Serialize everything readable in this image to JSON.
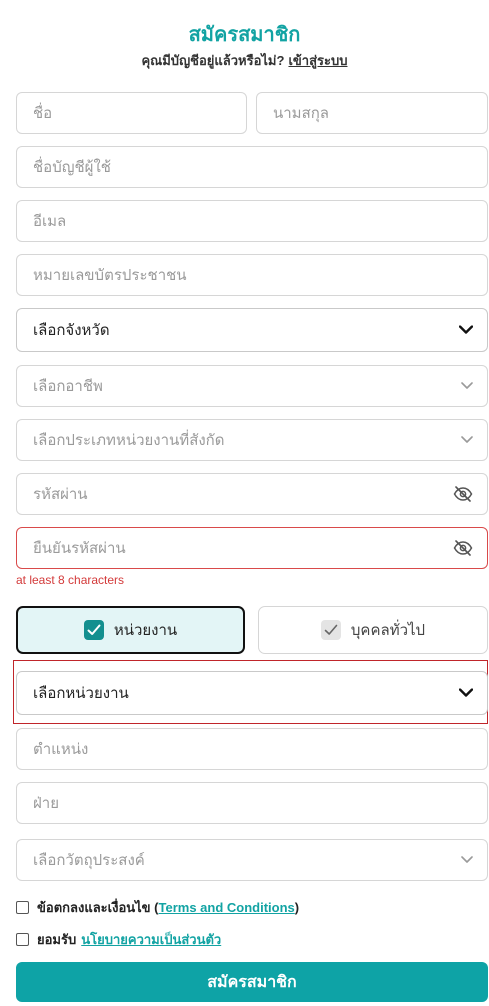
{
  "header": {
    "title": "สมัครสมาชิก",
    "question": "คุณมีบัญชีอยู่แล้วหรือไม่?",
    "login_link": "เข้าสู่ระบบ"
  },
  "form": {
    "first_name_placeholder": "ชื่อ",
    "last_name_placeholder": "นามสกุล",
    "username_placeholder": "ชื่อบัญชีผู้ใช้",
    "email_placeholder": "อีเมล",
    "id_card_placeholder": "หมายเลขบัตรประชาชน",
    "province_selected": "เลือกจังหวัด",
    "occupation_placeholder": "เลือกอาชีพ",
    "org_type_placeholder": "เลือกประเภทหน่วยงานที่สังกัด",
    "password_placeholder": "รหัสผ่าน",
    "confirm_password_placeholder": "ยืนยันรหัสผ่าน",
    "confirm_password_error": "at least 8 characters",
    "member_type": {
      "options": [
        "หน่วยงาน",
        "บุคคลทั่วไป"
      ],
      "selected": "หน่วยงาน"
    },
    "agency_selected": "เลือกหน่วยงาน",
    "position_placeholder": "ตำแหน่ง",
    "department_placeholder": "ฝ่าย",
    "purpose_placeholder": "เลือกวัตถุประสงค์",
    "terms_prefix": "ข้อตกลงและเงื่อนไข (",
    "terms_link": "Terms and Conditions",
    "terms_suffix": ")",
    "privacy_prefix": "ยอมรับ",
    "privacy_link": "นโยบายความเป็นส่วนตัว",
    "submit_label": "สมัครสมาชิก"
  },
  "colors": {
    "accent": "#0ea3a6",
    "error": "#d33a3a",
    "active_toggle_bg": "#e3f5f6"
  }
}
